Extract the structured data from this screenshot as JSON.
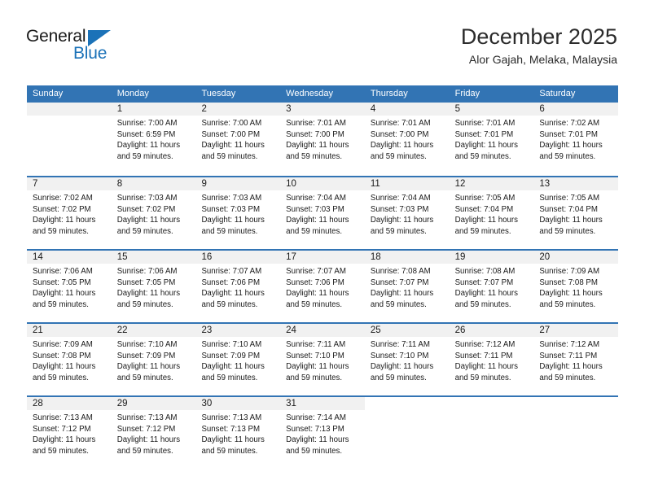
{
  "brand": {
    "name_top": "General",
    "name_bottom": "Blue",
    "accent_color": "#1b72b8"
  },
  "header": {
    "title": "December 2025",
    "subtitle": "Alor Gajah, Melaka, Malaysia"
  },
  "calendar": {
    "header_bg": "#3274b4",
    "day_number_bg": "#f1f1f1",
    "weekdays": [
      "Sunday",
      "Monday",
      "Tuesday",
      "Wednesday",
      "Thursday",
      "Friday",
      "Saturday"
    ],
    "weeks": [
      [
        {
          "day": "",
          "empty": true
        },
        {
          "day": "1",
          "sunrise": "Sunrise: 7:00 AM",
          "sunset": "Sunset: 6:59 PM",
          "daylight": "Daylight: 11 hours and 59 minutes."
        },
        {
          "day": "2",
          "sunrise": "Sunrise: 7:00 AM",
          "sunset": "Sunset: 7:00 PM",
          "daylight": "Daylight: 11 hours and 59 minutes."
        },
        {
          "day": "3",
          "sunrise": "Sunrise: 7:01 AM",
          "sunset": "Sunset: 7:00 PM",
          "daylight": "Daylight: 11 hours and 59 minutes."
        },
        {
          "day": "4",
          "sunrise": "Sunrise: 7:01 AM",
          "sunset": "Sunset: 7:00 PM",
          "daylight": "Daylight: 11 hours and 59 minutes."
        },
        {
          "day": "5",
          "sunrise": "Sunrise: 7:01 AM",
          "sunset": "Sunset: 7:01 PM",
          "daylight": "Daylight: 11 hours and 59 minutes."
        },
        {
          "day": "6",
          "sunrise": "Sunrise: 7:02 AM",
          "sunset": "Sunset: 7:01 PM",
          "daylight": "Daylight: 11 hours and 59 minutes."
        }
      ],
      [
        {
          "day": "7",
          "sunrise": "Sunrise: 7:02 AM",
          "sunset": "Sunset: 7:02 PM",
          "daylight": "Daylight: 11 hours and 59 minutes."
        },
        {
          "day": "8",
          "sunrise": "Sunrise: 7:03 AM",
          "sunset": "Sunset: 7:02 PM",
          "daylight": "Daylight: 11 hours and 59 minutes."
        },
        {
          "day": "9",
          "sunrise": "Sunrise: 7:03 AM",
          "sunset": "Sunset: 7:03 PM",
          "daylight": "Daylight: 11 hours and 59 minutes."
        },
        {
          "day": "10",
          "sunrise": "Sunrise: 7:04 AM",
          "sunset": "Sunset: 7:03 PM",
          "daylight": "Daylight: 11 hours and 59 minutes."
        },
        {
          "day": "11",
          "sunrise": "Sunrise: 7:04 AM",
          "sunset": "Sunset: 7:03 PM",
          "daylight": "Daylight: 11 hours and 59 minutes."
        },
        {
          "day": "12",
          "sunrise": "Sunrise: 7:05 AM",
          "sunset": "Sunset: 7:04 PM",
          "daylight": "Daylight: 11 hours and 59 minutes."
        },
        {
          "day": "13",
          "sunrise": "Sunrise: 7:05 AM",
          "sunset": "Sunset: 7:04 PM",
          "daylight": "Daylight: 11 hours and 59 minutes."
        }
      ],
      [
        {
          "day": "14",
          "sunrise": "Sunrise: 7:06 AM",
          "sunset": "Sunset: 7:05 PM",
          "daylight": "Daylight: 11 hours and 59 minutes."
        },
        {
          "day": "15",
          "sunrise": "Sunrise: 7:06 AM",
          "sunset": "Sunset: 7:05 PM",
          "daylight": "Daylight: 11 hours and 59 minutes."
        },
        {
          "day": "16",
          "sunrise": "Sunrise: 7:07 AM",
          "sunset": "Sunset: 7:06 PM",
          "daylight": "Daylight: 11 hours and 59 minutes."
        },
        {
          "day": "17",
          "sunrise": "Sunrise: 7:07 AM",
          "sunset": "Sunset: 7:06 PM",
          "daylight": "Daylight: 11 hours and 59 minutes."
        },
        {
          "day": "18",
          "sunrise": "Sunrise: 7:08 AM",
          "sunset": "Sunset: 7:07 PM",
          "daylight": "Daylight: 11 hours and 59 minutes."
        },
        {
          "day": "19",
          "sunrise": "Sunrise: 7:08 AM",
          "sunset": "Sunset: 7:07 PM",
          "daylight": "Daylight: 11 hours and 59 minutes."
        },
        {
          "day": "20",
          "sunrise": "Sunrise: 7:09 AM",
          "sunset": "Sunset: 7:08 PM",
          "daylight": "Daylight: 11 hours and 59 minutes."
        }
      ],
      [
        {
          "day": "21",
          "sunrise": "Sunrise: 7:09 AM",
          "sunset": "Sunset: 7:08 PM",
          "daylight": "Daylight: 11 hours and 59 minutes."
        },
        {
          "day": "22",
          "sunrise": "Sunrise: 7:10 AM",
          "sunset": "Sunset: 7:09 PM",
          "daylight": "Daylight: 11 hours and 59 minutes."
        },
        {
          "day": "23",
          "sunrise": "Sunrise: 7:10 AM",
          "sunset": "Sunset: 7:09 PM",
          "daylight": "Daylight: 11 hours and 59 minutes."
        },
        {
          "day": "24",
          "sunrise": "Sunrise: 7:11 AM",
          "sunset": "Sunset: 7:10 PM",
          "daylight": "Daylight: 11 hours and 59 minutes."
        },
        {
          "day": "25",
          "sunrise": "Sunrise: 7:11 AM",
          "sunset": "Sunset: 7:10 PM",
          "daylight": "Daylight: 11 hours and 59 minutes."
        },
        {
          "day": "26",
          "sunrise": "Sunrise: 7:12 AM",
          "sunset": "Sunset: 7:11 PM",
          "daylight": "Daylight: 11 hours and 59 minutes."
        },
        {
          "day": "27",
          "sunrise": "Sunrise: 7:12 AM",
          "sunset": "Sunset: 7:11 PM",
          "daylight": "Daylight: 11 hours and 59 minutes."
        }
      ],
      [
        {
          "day": "28",
          "sunrise": "Sunrise: 7:13 AM",
          "sunset": "Sunset: 7:12 PM",
          "daylight": "Daylight: 11 hours and 59 minutes."
        },
        {
          "day": "29",
          "sunrise": "Sunrise: 7:13 AM",
          "sunset": "Sunset: 7:12 PM",
          "daylight": "Daylight: 11 hours and 59 minutes."
        },
        {
          "day": "30",
          "sunrise": "Sunrise: 7:13 AM",
          "sunset": "Sunset: 7:13 PM",
          "daylight": "Daylight: 11 hours and 59 minutes."
        },
        {
          "day": "31",
          "sunrise": "Sunrise: 7:14 AM",
          "sunset": "Sunset: 7:13 PM",
          "daylight": "Daylight: 11 hours and 59 minutes."
        },
        {
          "day": "",
          "empty": true,
          "blank": true
        },
        {
          "day": "",
          "empty": true,
          "blank": true
        },
        {
          "day": "",
          "empty": true,
          "blank": true
        }
      ]
    ]
  }
}
